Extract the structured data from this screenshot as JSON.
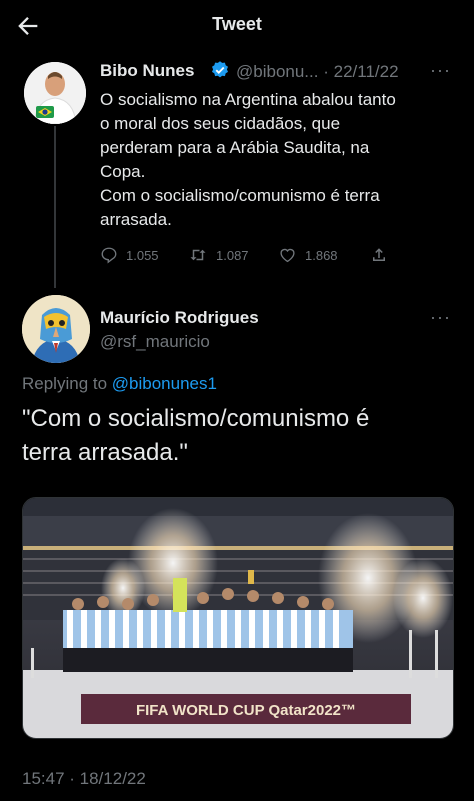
{
  "header": {
    "title": "Tweet"
  },
  "quoted_tweet": {
    "author_name": "Bibo Nunes",
    "handle": "@bibonu...",
    "separator": "·",
    "date": "22/11/22",
    "lines": [
      "O socialismo na Argentina abalou tanto",
      "o moral dos seus cidadãos, que",
      "perderam para a Arábia Saudita, na",
      "Copa.",
      "Com o socialismo/comunismo é terra",
      "arrasada."
    ],
    "replies": "1.055",
    "retweets": "1.087",
    "likes": "1.868"
  },
  "main_tweet": {
    "author_name": "Maurício Rodrigues",
    "handle": "@rsf_mauricio",
    "replying_prefix": "Replying to ",
    "replying_handle": "@bibonunes1",
    "text_lines": [
      "\"Com o socialismo/comunismo é",
      "terra arrasada.\""
    ],
    "media_banner": "FIFA WORLD CUP Qatar2022™",
    "timestamp": "15:47 · 18/12/22"
  },
  "colors": {
    "background": "#000000",
    "text": "#e7e9ea",
    "muted": "#71767b",
    "link": "#1d9bf0",
    "verified": "#1d9bf0"
  },
  "icons": [
    "back-arrow-icon",
    "verified-badge-icon",
    "more-icon",
    "reply-icon",
    "retweet-icon",
    "like-icon",
    "share-icon"
  ]
}
